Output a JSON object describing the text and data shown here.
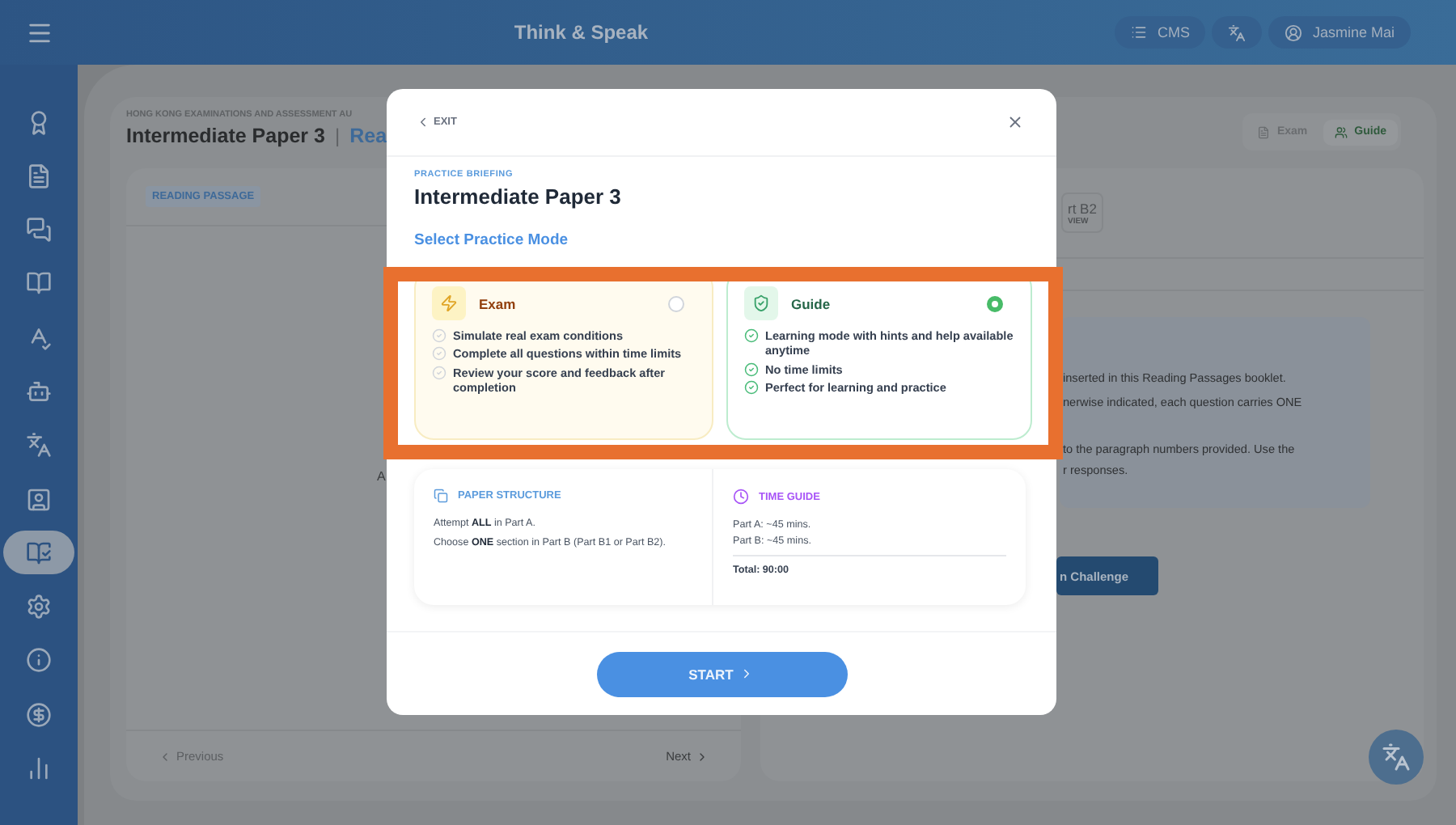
{
  "top_bar": {
    "title": "Think & Speak",
    "cms": "CMS",
    "user": "Jasmine Mai"
  },
  "sidebar": {
    "items": [
      {
        "selected": false
      },
      {
        "selected": false
      },
      {
        "selected": false
      },
      {
        "selected": false
      },
      {
        "selected": false
      },
      {
        "selected": false
      },
      {
        "selected": false
      },
      {
        "selected": false
      },
      {
        "selected": true
      },
      {
        "selected": false
      },
      {
        "selected": false
      },
      {
        "selected": false
      },
      {
        "selected": false
      }
    ]
  },
  "page": {
    "organization": "HONG KONG EXAMINATIONS AND ASSESSMENT AU",
    "title": "Intermediate Paper 3",
    "separator": "|",
    "subtitle": "Rea",
    "mode_toggle": [
      {
        "label": "Exam",
        "selected": false
      },
      {
        "label": "Guide",
        "selected": true
      }
    ],
    "left_panel": {
      "tag": "READING PASSAGE",
      "fragment": "A",
      "previous": "Previous",
      "next": "Next"
    },
    "right_panel": {
      "tab": {
        "label": "rt B2",
        "sub": "VIEW"
      },
      "instructions": [
        "inserted in this Reading Passages booklet.",
        "nerwise indicated, each question carries ONE",
        "to the paragraph numbers provided. Use the",
        "r responses."
      ],
      "button": "n Challenge"
    }
  },
  "modal": {
    "exit": "EXIT",
    "eyebrow": "PRACTICE BRIEFING",
    "title": "Intermediate Paper 3",
    "section_label": "Select Practice Mode",
    "modes": [
      {
        "kind": "exam",
        "name": "Exam",
        "selected": false,
        "features": [
          "Simulate real exam conditions",
          "Complete all questions within time limits",
          "Review your score and feedback after completion"
        ]
      },
      {
        "kind": "guide",
        "name": "Guide",
        "selected": true,
        "features": [
          "Learning mode with hints and help available anytime",
          "No time limits",
          "Perfect for learning and practice"
        ]
      }
    ],
    "structure": {
      "heading": "PAPER STRUCTURE",
      "lines": [
        "Attempt **ALL** in Part A.",
        "Choose **ONE** section in Part B (Part B1 or Part B2)."
      ]
    },
    "time_guide": {
      "heading": "TIME GUIDE",
      "lines": [
        "Part A: ~45 mins.",
        "Part B: ~45 mins."
      ],
      "total": "Total: 90:00"
    },
    "start": "START"
  }
}
